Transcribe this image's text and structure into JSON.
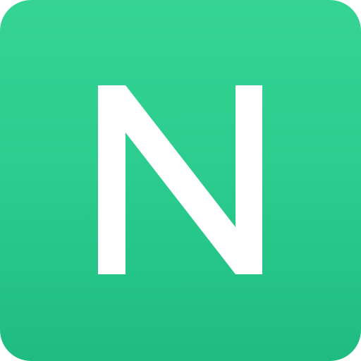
{
  "icon": {
    "name": "app-icon",
    "glyph_name": "n-letter-logo",
    "letter": "N",
    "background_color_top": "#35d495",
    "background_color_bottom": "#1fbc82",
    "glyph_color": "#ffffff"
  }
}
